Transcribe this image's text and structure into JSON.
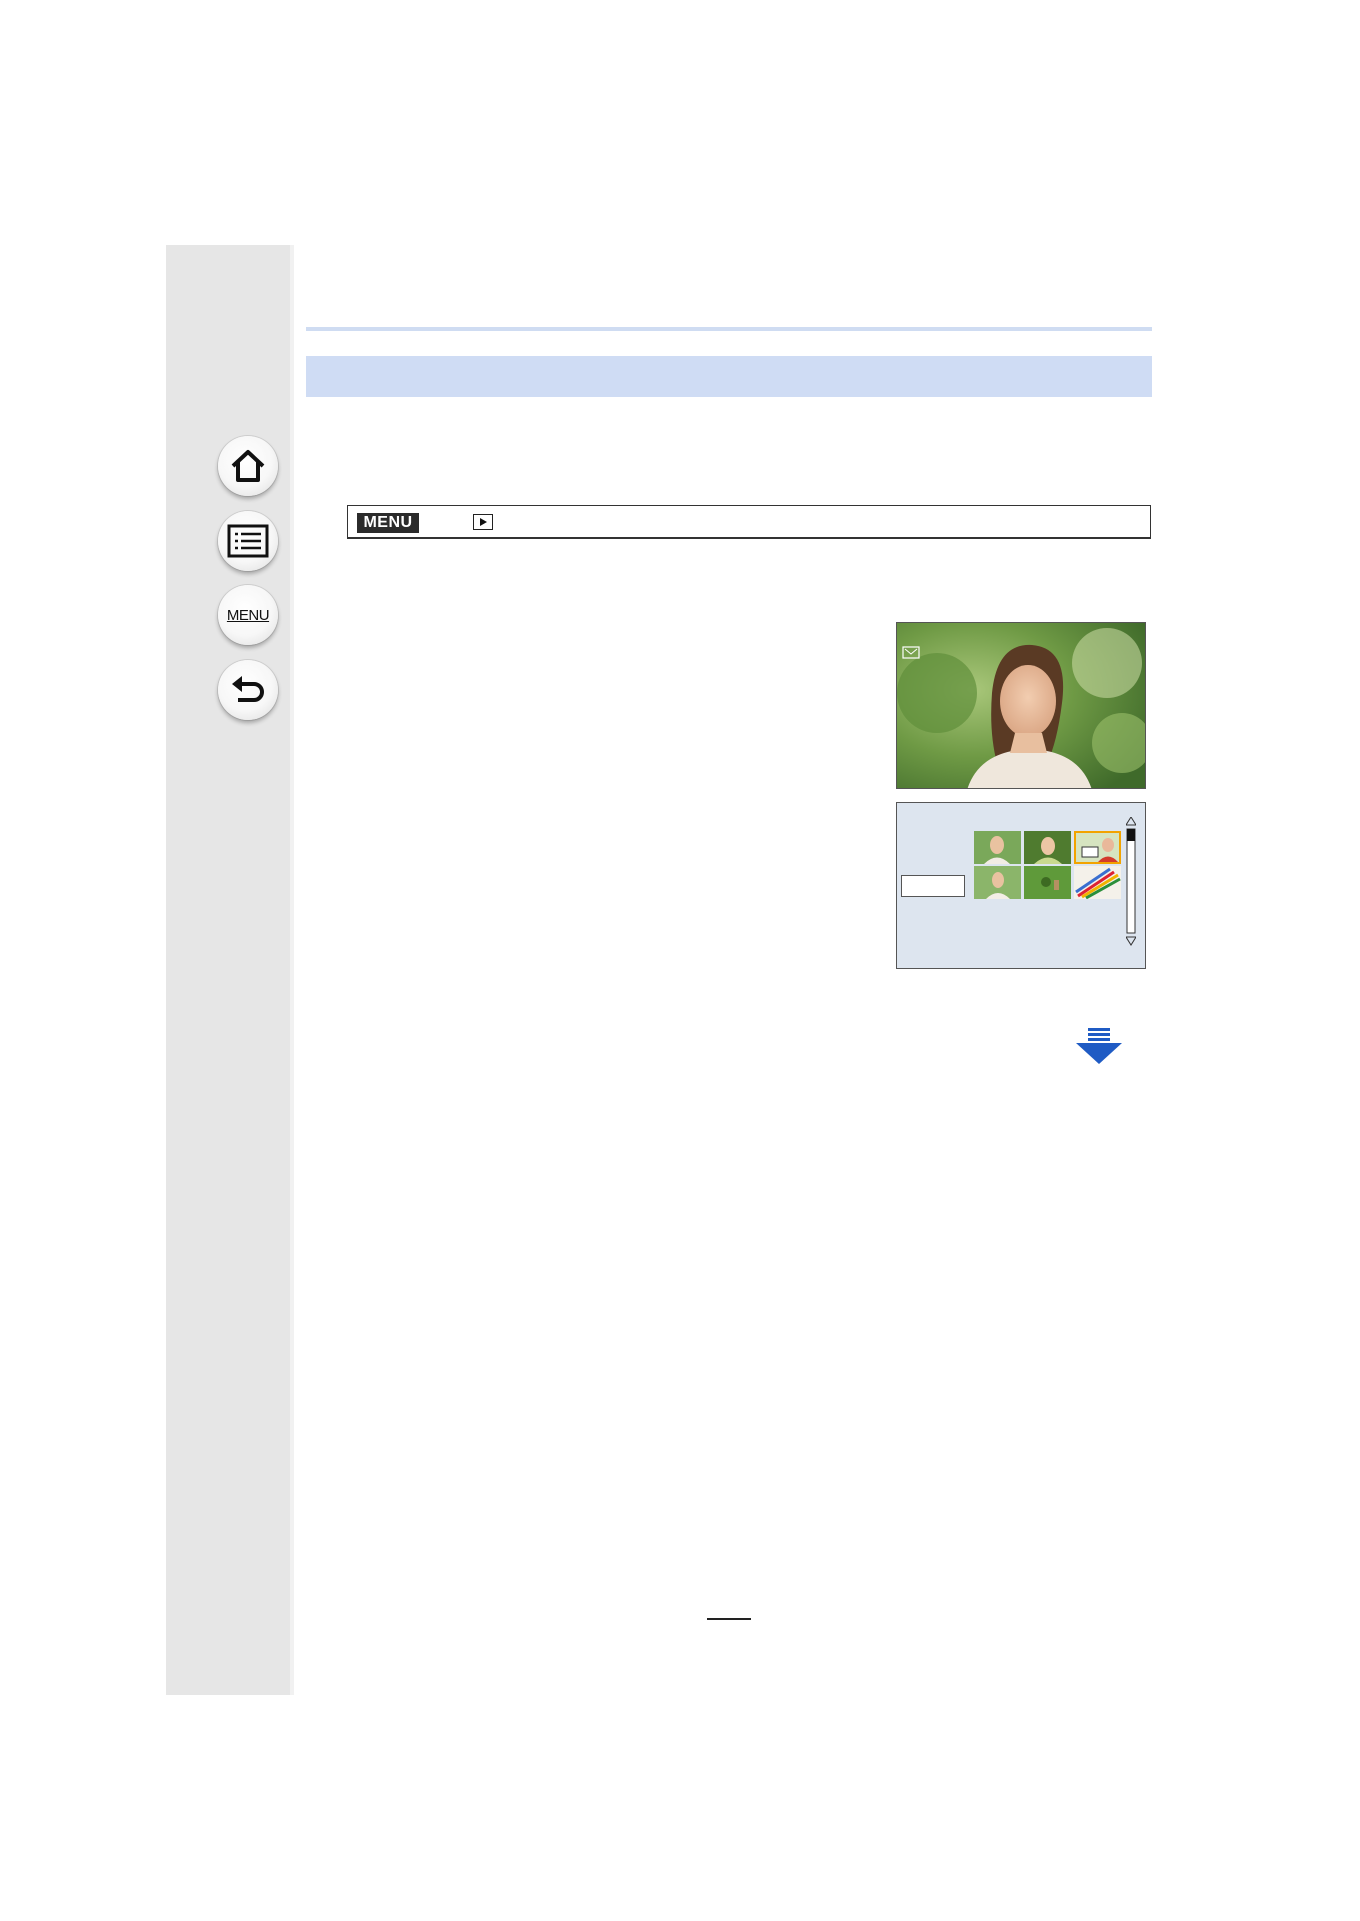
{
  "sidebar": {
    "home_icon": "home-icon",
    "contents_icon": "list-icon",
    "menu_label": "MENU",
    "back_icon": "back-arrow-icon"
  },
  "menu_path": {
    "badge": "MENU",
    "mode_icon": "playback-icon"
  },
  "colors": {
    "title_bar": "#cfdcf4",
    "sidebar_bg": "#e6e6e6",
    "next_arrow": "#1f5bc4",
    "selection_frame": "#f2a300"
  },
  "next_page_icon": "next-page-arrow-icon"
}
